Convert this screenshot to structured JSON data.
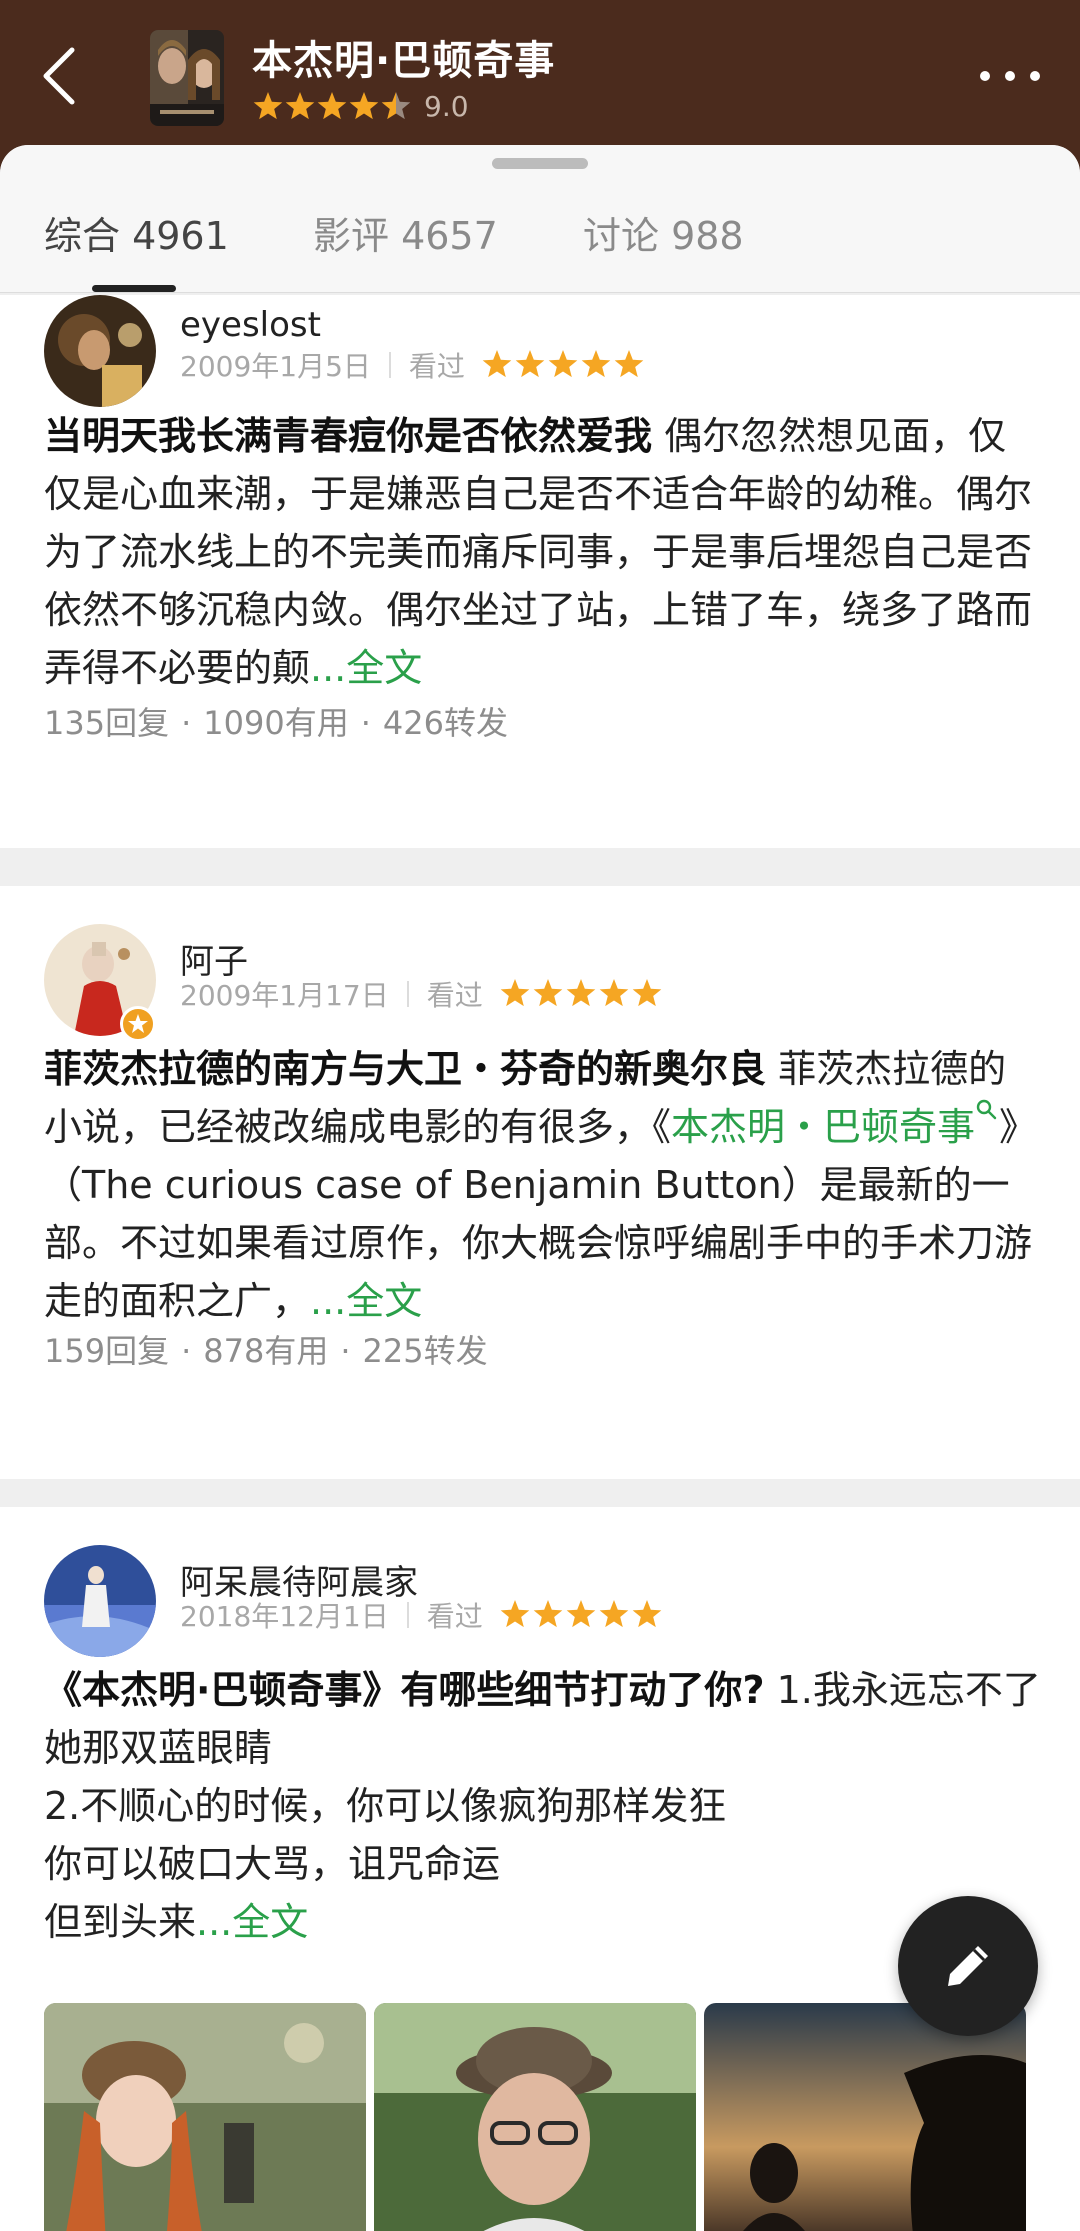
{
  "header": {
    "title": "本杰明·巴顿奇事",
    "rating": "9.0",
    "rating_stars": 4.5
  },
  "tabs": [
    {
      "label": "综合 4961",
      "active": true
    },
    {
      "label": "影评 4657",
      "active": false
    },
    {
      "label": "讨论 988",
      "active": false
    }
  ],
  "colors": {
    "header_bg": "#4b2b1d",
    "star": "#f5a623",
    "link_green": "#2aa04a"
  },
  "reviews": [
    {
      "user": "eyeslost",
      "date": "2009年1月5日",
      "status": "看过",
      "stars": 5,
      "title": "当明天我长满青春痘你是否依然爱我",
      "text": "偶尔忽然想见面，仅仅是心血来潮，于是嫌恶自己是否不适合年龄的幼稚。偶尔为了流水线上的不完美而痛斥同事，于是事后埋怨自己是否依然不够沉稳内敛。偶尔坐过了站，上错了车，绕多了路而弄得不必要的颠",
      "more": "...全文",
      "replies": "135回复",
      "useful": "1090有用",
      "shares": "426转发"
    },
    {
      "user": "阿子",
      "date": "2009年1月17日",
      "status": "看过",
      "stars": 5,
      "title": "菲茨杰拉德的南方与大卫・芬奇的新奥尔良",
      "text_a": "菲茨杰拉德的小说，已经被改编成电影的有很多，《",
      "link": "本杰明・巴顿奇事",
      "text_b": "》（The curious case of Benjamin Button）是最新的一部。不过如果看过原作，你大概会惊呼编剧手中的手术刀游走的面积之广，",
      "more": "...全文",
      "replies": "159回复",
      "useful": "878有用",
      "shares": "225转发"
    },
    {
      "user": "阿呆晨待阿晨家",
      "date": "2018年12月1日",
      "status": "看过",
      "stars": 5,
      "title": "《本杰明·巴顿奇事》有哪些细节打动了你?",
      "line1": "1.我永远忘不了她那双蓝眼睛",
      "line2": "2.不顺心的时候，你可以像疯狗那样发狂",
      "line3": "你可以破口大骂，诅咒命运",
      "line4": "但到头来",
      "more": "...全文"
    }
  ],
  "fab_icon": "pencil-icon"
}
